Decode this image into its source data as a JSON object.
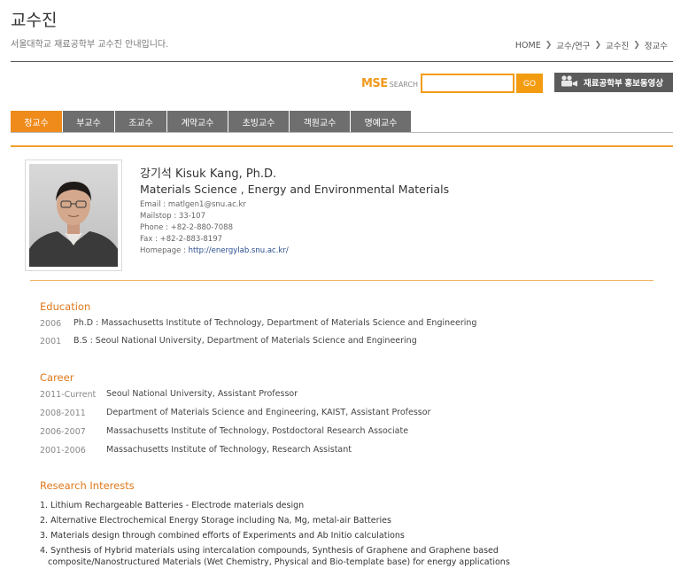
{
  "header": {
    "title": "교수진",
    "subtitle": "서울대학교 재료공학부 교수진 안내입니다."
  },
  "breadcrumb": [
    "HOME",
    "교수/연구",
    "교수진",
    "정교수"
  ],
  "search": {
    "logo": "MSE",
    "label": "SEARCH",
    "value": "",
    "placeholder": "",
    "go_label": "GO"
  },
  "promo": {
    "label": "재료공학부 홍보동영상",
    "icon": "video-camera-icon"
  },
  "tabs": [
    {
      "label": "정교수",
      "active": true
    },
    {
      "label": "부교수",
      "active": false
    },
    {
      "label": "조교수",
      "active": false
    },
    {
      "label": "계약교수",
      "active": false
    },
    {
      "label": "초빙교수",
      "active": false
    },
    {
      "label": "객원교수",
      "active": false
    },
    {
      "label": "명예교수",
      "active": false
    }
  ],
  "professor": {
    "name": "강기석 Kisuk Kang, Ph.D.",
    "field": "Materials Science , Energy and Environmental Materials",
    "email": "Email : matlgen1@snu.ac.kr",
    "mailstop": "Mailstop : 33-107",
    "phone": "Phone : +82-2-880-7088",
    "fax": "Fax : +82-2-883-8197",
    "homepage_label": "Homepage : ",
    "homepage_url": "http://energylab.snu.ac.kr/"
  },
  "education": {
    "title": "Education",
    "items": [
      {
        "year": "2006",
        "text": "Ph.D : Massachusetts Institute of Technology, Department of Materials Science and Engineering"
      },
      {
        "year": "2001",
        "text": "B.S : Seoul National University, Department of Materials Science and Engineering"
      }
    ]
  },
  "career": {
    "title": "Career",
    "items": [
      {
        "year": "2011-Current",
        "text": "Seoul National University, Assistant Professor"
      },
      {
        "year": "2008-2011",
        "text": "Department of Materials Science and Engineering, KAIST, Assistant Professor"
      },
      {
        "year": "2006-2007",
        "text": "Massachusetts Institute of Technology, Postdoctoral Research Associate"
      },
      {
        "year": "2001-2006",
        "text": "Massachusetts Institute of Technology, Research Assistant"
      }
    ]
  },
  "research": {
    "title": "Research Interests",
    "items": [
      "1. Lithium Rechargeable Batteries - Electrode materials design",
      "2. Alternative Electrochemical Energy Storage including Na, Mg, metal-air Batteries",
      "3. Materials design through combined efforts of Experiments and Ab Initio calculations",
      "4. Synthesis of Hybrid materials using intercalation compounds, Synthesis of Graphene and Graphene based",
      "   composite/Nanostructured Materials (Wet Chemistry, Physical and Bio-template base) for energy applications"
    ]
  }
}
